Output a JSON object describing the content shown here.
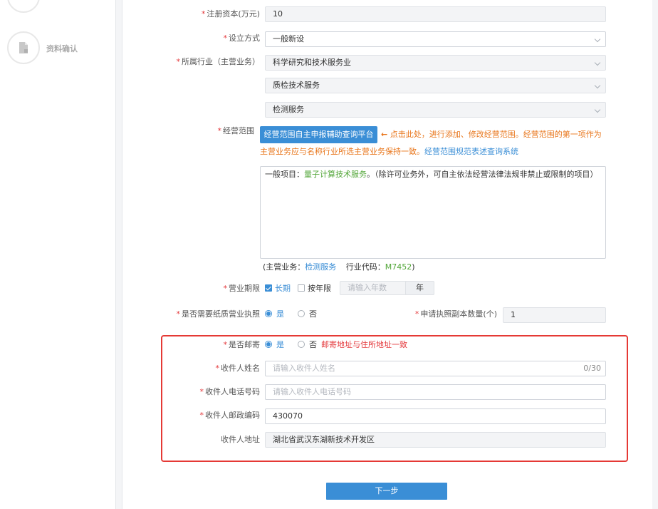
{
  "sidebar": {
    "steps": [
      {
        "label": "",
        "icon": "upload-icon"
      },
      {
        "label": "资料确认",
        "icon": "document-icon"
      }
    ]
  },
  "form": {
    "capital": {
      "label": "注册资本(万元)",
      "value": "10"
    },
    "setup_method": {
      "label": "设立方式",
      "value": "一般新设"
    },
    "industry": {
      "label": "所属行业（主营业务）",
      "level1": "科学研究和技术服务业",
      "level2": "质检技术服务",
      "level3": "检测服务"
    },
    "scope": {
      "label": "经营范围",
      "button": "经营范围自主申报辅助查询平台",
      "hint_arrow": "←",
      "hint_part1": "点击此处，进行添加、修改经营范围。经营范围的第一项作为",
      "hint_part2": "主营业务应与名称行业所选主营业务保持一致。",
      "hint_link": "经营范围规范表述查询系统",
      "text_prefix": "一般项目：",
      "text_highlight": "量子计算技术服务",
      "text_suffix": "。（除许可业务外，可自主依法经营法律法规非禁止或限制的项目）",
      "main_business_prefix": "(主营业务：",
      "main_business_value": "检测服务",
      "industry_code_prefix": "行业代码：",
      "industry_code_value": "M7452",
      "close_paren": ")"
    },
    "term": {
      "label": "营业期限",
      "option_long": "长期",
      "option_years": "按年限",
      "years_placeholder": "请输入年数",
      "years_unit": "年"
    },
    "paper_license": {
      "label": "是否需要纸质营业执照",
      "yes": "是",
      "no": "否",
      "copies_label": "申请执照副本数量(个)",
      "copies_value": "1"
    },
    "mail": {
      "label": "是否邮寄",
      "yes": "是",
      "no": "否",
      "note": "邮寄地址与住所地址一致"
    },
    "recipient_name": {
      "label": "收件人姓名",
      "placeholder": "请输入收件人姓名",
      "counter": "0/30"
    },
    "recipient_phone": {
      "label": "收件人电话号码",
      "placeholder": "请输入收件人电话号码"
    },
    "recipient_zip": {
      "label": "收件人邮政编码",
      "value": "430070"
    },
    "recipient_address": {
      "label": "收件人地址",
      "value": "湖北省武汉东湖新技术开发区"
    }
  },
  "footer": {
    "next_label": "下一步"
  },
  "colors": {
    "primary": "#3a8ed6",
    "warning": "#e8751a",
    "danger": "#e53935",
    "success": "#52a638"
  }
}
